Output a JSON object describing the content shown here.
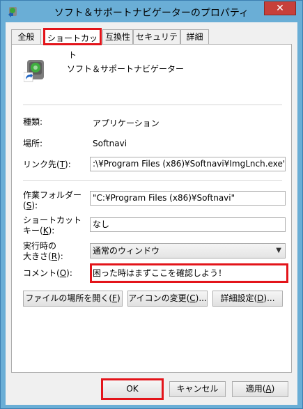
{
  "window": {
    "title": "ソフト＆サポートナビゲーターのプロパティ",
    "close_label": "✕"
  },
  "tabs": [
    {
      "label": "全般"
    },
    {
      "label": "ショートカット"
    },
    {
      "label": "互換性"
    },
    {
      "label": "セキュリティ"
    },
    {
      "label": "詳細"
    }
  ],
  "app": {
    "name": "ソフト＆サポートナビゲーター"
  },
  "info": {
    "type_label": "種類:",
    "type_value": "アプリケーション",
    "location_label": "場所:",
    "location_value": "Softnavi",
    "target_label_a": "リンク先(",
    "target_key": "T",
    "target_label_b": "):",
    "target_value": ":\\¥Program Files (x86)¥Softnavi¥ImgLnch.exe\""
  },
  "fields": {
    "startin_label_a": "作業フォルダー",
    "startin_label_b1": "(",
    "startin_key": "S",
    "startin_label_b2": "):",
    "startin_value": "\"C:¥Program Files (x86)¥Softnavi\"",
    "shortcut_label_a": "ショートカット",
    "shortcut_label_b1": "キー(",
    "shortcut_key": "K",
    "shortcut_label_b2": "):",
    "shortcut_value": "なし",
    "run_label_a": "実行時の",
    "run_label_b1": "大きさ(",
    "run_key": "R",
    "run_label_b2": "):",
    "run_value": "通常のウィンドウ",
    "comment_label_a": "コメント(",
    "comment_key": "O",
    "comment_label_b": "):",
    "comment_value": "困った時はまずここを確認しよう！"
  },
  "actions": {
    "open_location_a": "ファイルの場所を開く(",
    "open_location_key": "F",
    "open_location_b": ")",
    "change_icon_a": "アイコンの変更(",
    "change_icon_key": "C",
    "change_icon_b": ")...",
    "advanced_a": "詳細設定(",
    "advanced_key": "D",
    "advanced_b": ")..."
  },
  "footer": {
    "ok_label": "OK",
    "cancel_label": "キャンセル",
    "apply_a": "適用(",
    "apply_key": "A",
    "apply_b": ")"
  }
}
